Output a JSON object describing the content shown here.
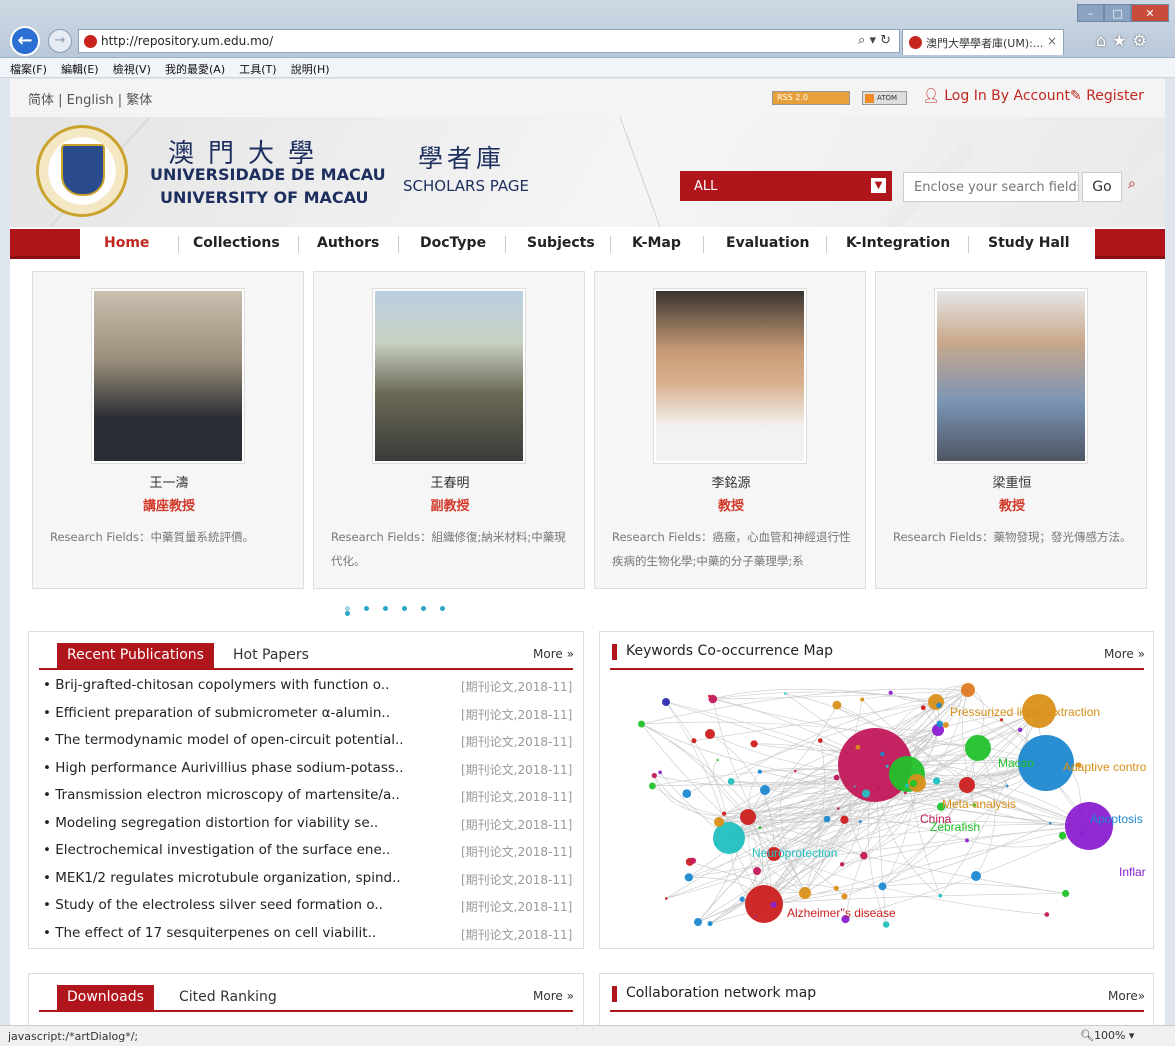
{
  "browser": {
    "url": "http://repository.um.edu.mo/",
    "tab_title": "澳門大學學者庫(UM):...",
    "menu": [
      "檔案(F)",
      "編輯(E)",
      "檢視(V)",
      "我的最愛(A)",
      "工具(T)",
      "說明(H)"
    ],
    "status_text": "javascript:/*artDialog*/;",
    "zoom": "100%"
  },
  "topbar": {
    "languages": "简体 | English | 繁体",
    "rss": "RSS 2.0",
    "atom": "ATOM",
    "login": "Log In By Account",
    "register": "Register"
  },
  "header": {
    "logo_cn": "澳門大學",
    "logo_pt": "UNIVERSIDADE DE MACAU",
    "logo_en": "UNIVERSITY OF MACAU",
    "scholars_cn": "學者庫",
    "scholars_en": "SCHOLARS PAGE",
    "search_scope": "ALL",
    "search_placeholder": "Enclose your search fields",
    "go": "Go"
  },
  "nav": [
    "Home",
    "Collections",
    "Authors",
    "DocType",
    "Subjects",
    "K-Map",
    "Evaluation",
    "K-Integration",
    "Study Hall"
  ],
  "scholars": [
    {
      "name": "王一濤",
      "title": "講座教授",
      "fields": "Research Fields：中藥質量系統評價。"
    },
    {
      "name": "王春明",
      "title": "副教授",
      "fields": "Research Fields：組織修復;納米材料;中藥現代化。"
    },
    {
      "name": "李銘源",
      "title": "教授",
      "fields": "Research Fields：癌癥，心血管和神經退行性疾病的生物化學;中藥的分子藥理學;系"
    },
    {
      "name": "梁重恒",
      "title": "教授",
      "fields": "Research Fields：藥物發現；發光傳感方法。"
    }
  ],
  "publications": {
    "tab_recent": "Recent Publications",
    "tab_hot": "Hot Papers",
    "more": "More »",
    "items": [
      {
        "title": "Brij-grafted-chitosan copolymers with function o..",
        "date": "[期刊论文,2018-11]"
      },
      {
        "title": "Efficient preparation of submicrometer α-alumin..",
        "date": "[期刊论文,2018-11]"
      },
      {
        "title": "The termodynamic model of open-circuit potential..",
        "date": "[期刊论文,2018-11]"
      },
      {
        "title": "High performance Aurivillius phase sodium-potass..",
        "date": "[期刊论文,2018-11]"
      },
      {
        "title": "Transmission electron microscopy of martensite/a..",
        "date": "[期刊论文,2018-11]"
      },
      {
        "title": "Modeling segregation distortion for viability se..",
        "date": "[期刊论文,2018-11]"
      },
      {
        "title": "Electrochemical investigation of the surface ene..",
        "date": "[期刊论文,2018-11]"
      },
      {
        "title": "MEK1/2 regulates microtubule organization, spind..",
        "date": "[期刊论文,2018-11]"
      },
      {
        "title": "Study of the electroless silver seed formation o..",
        "date": "[期刊论文,2018-11]"
      },
      {
        "title": "The effect of 17 sesquiterpenes on cell viabilit..",
        "date": "[期刊论文,2018-11]"
      }
    ]
  },
  "keywords": {
    "title": "Keywords Co-occurrence Map",
    "more": "More »",
    "labels": [
      "Pressurized liquid extraction",
      "Macao",
      "Adaptive contro",
      "Meta-analysis",
      "China",
      "Zebrafish",
      "Apoptosis",
      "Neuroprotection",
      "Inflar",
      "Alzheimer''s disease"
    ],
    "colors": {
      "magenta": "#c2185b",
      "green": "#22c22a",
      "teal": "#23c0c0",
      "orange": "#d9901a",
      "blue": "#1e88d0",
      "purple": "#8b1fd0",
      "red": "#cc1f1f"
    }
  },
  "downloads": {
    "tab_downloads": "Downloads",
    "tab_cited": "Cited Ranking",
    "more": "More »"
  },
  "collab": {
    "title": "Collaboration network map",
    "more": "More»"
  }
}
